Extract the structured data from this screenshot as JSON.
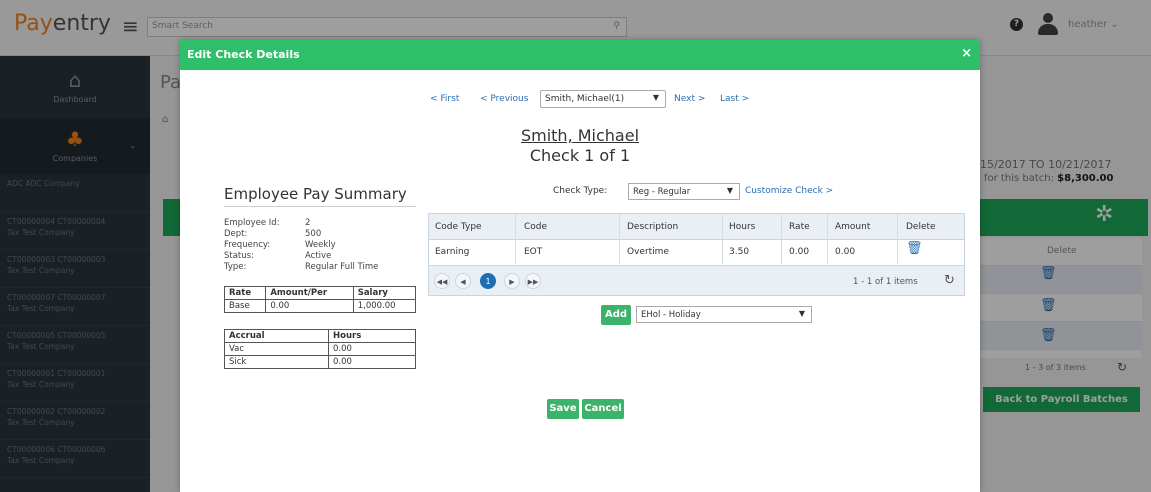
{
  "app": {
    "brand_pay": "Pay",
    "brand_entry": "entry"
  },
  "search": {
    "placeholder": "Smart Search"
  },
  "user": {
    "name": "heather ⌄"
  },
  "sidebar": {
    "items": [
      {
        "label": "Dashboard",
        "icon": "home-icon"
      },
      {
        "label": "Companies",
        "icon": "companies-icon"
      }
    ],
    "companies": [
      {
        "line1": "ADC ADC Company",
        "line2": ""
      },
      {
        "line1": "CT00000004 CT00000004",
        "line2": "Tax Test Company"
      },
      {
        "line1": "CT00000003 CT00000003",
        "line2": "Tax Test Company"
      },
      {
        "line1": "CT00000007 CT00000007",
        "line2": "Tax Test Company"
      },
      {
        "line1": "CT00000005 CT00000005",
        "line2": "Tax Test Company"
      },
      {
        "line1": "CT00000001 CT00000001",
        "line2": "Tax Test Company"
      },
      {
        "line1": "CT00000002 CT00000002",
        "line2": "Tax Test Company"
      },
      {
        "line1": "CT00000006 CT00000006",
        "line2": "Tax Test Company"
      }
    ]
  },
  "background": {
    "page_title": "Pa",
    "date_range": "15/2017 TO 10/21/2017",
    "batch_total_label": "for this batch:",
    "batch_total_value": "$8,300.00",
    "delete_header": "Delete",
    "pager": "1 - 3 of 3 items",
    "back_button": "Back to Payroll Batches"
  },
  "modal": {
    "title": "Edit Check Details",
    "nav": {
      "first": "< First",
      "previous": "< Previous",
      "employee_selected": "Smith, Michael(1)",
      "next": "Next >",
      "last": "Last >"
    },
    "employee_name": "Smith, Michael",
    "check_of": "Check 1 of 1",
    "summary": {
      "title": "Employee Pay Summary",
      "fields": [
        {
          "label": "Employee Id:",
          "value": "2"
        },
        {
          "label": "Dept:",
          "value": "500"
        },
        {
          "label": "Frequency:",
          "value": "Weekly"
        },
        {
          "label": "Status:",
          "value": "Active"
        },
        {
          "label": "Type:",
          "value": "Regular Full Time"
        }
      ],
      "rate_table": {
        "headers": [
          "Rate",
          "Amount/Per",
          "Salary"
        ],
        "row": [
          "Base",
          "0.00",
          "1,000.00"
        ]
      },
      "accrual_table": {
        "headers": [
          "Accrual",
          "Hours"
        ],
        "rows": [
          [
            "Vac",
            "0.00"
          ],
          [
            "Sick",
            "0.00"
          ]
        ]
      }
    },
    "check_type": {
      "label": "Check Type:",
      "selected": "Reg - Regular",
      "customize": "Customize Check >"
    },
    "grid": {
      "headers": [
        "Code Type",
        "Code",
        "Description",
        "Hours",
        "Rate",
        "Amount",
        "Delete"
      ],
      "row": [
        "Earning",
        "EOT",
        "Overtime",
        "3.50",
        "0.00",
        "0.00"
      ],
      "current_page": "1",
      "pager_info": "1 - 1 of 1 items"
    },
    "add": {
      "label": "Add",
      "selected": "EHol - Holiday"
    },
    "save": "Save",
    "cancel": "Cancel"
  }
}
